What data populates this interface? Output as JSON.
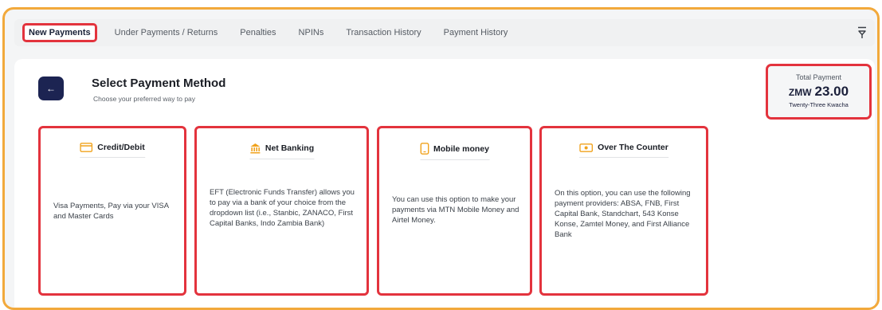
{
  "tabs": [
    {
      "label": "New Payments"
    },
    {
      "label": "Under Payments / Returns"
    },
    {
      "label": "Penalties"
    },
    {
      "label": "NPINs"
    },
    {
      "label": "Transaction History"
    },
    {
      "label": "Payment History"
    }
  ],
  "header": {
    "back_icon": "←",
    "title": "Select Payment Method",
    "subtitle": "Choose your preferred way to pay"
  },
  "total": {
    "label": "Total Payment",
    "currency": "ZMW",
    "amount": "23.00",
    "words": "Twenty-Three Kwacha"
  },
  "methods": [
    {
      "title": "Credit/Debit",
      "icon": "credit-card-icon",
      "description": "Visa Payments, Pay via your VISA and Master Cards"
    },
    {
      "title": "Net Banking",
      "icon": "bank-icon",
      "description": "EFT (Electronic Funds Transfer) allows you to pay via a bank of your choice from the dropdown list (i.e., Stanbic, ZANACO, First Capital Banks, Indo Zambia Bank)"
    },
    {
      "title": "Mobile money",
      "icon": "mobile-phone-icon",
      "description": "You can use this option to make your payments via MTN Mobile Money and Airtel Money."
    },
    {
      "title": "Over The Counter",
      "icon": "cash-icon",
      "description": "On this option, you can use the following payment providers: ABSA, FNB, First Capital Bank, Standchart, 543 Konse Konse, Zamtel Money, and First Alliance Bank"
    }
  ],
  "colors": {
    "accent": "#f2a93b",
    "highlight": "#e3333d",
    "navy": "#1c2452"
  }
}
